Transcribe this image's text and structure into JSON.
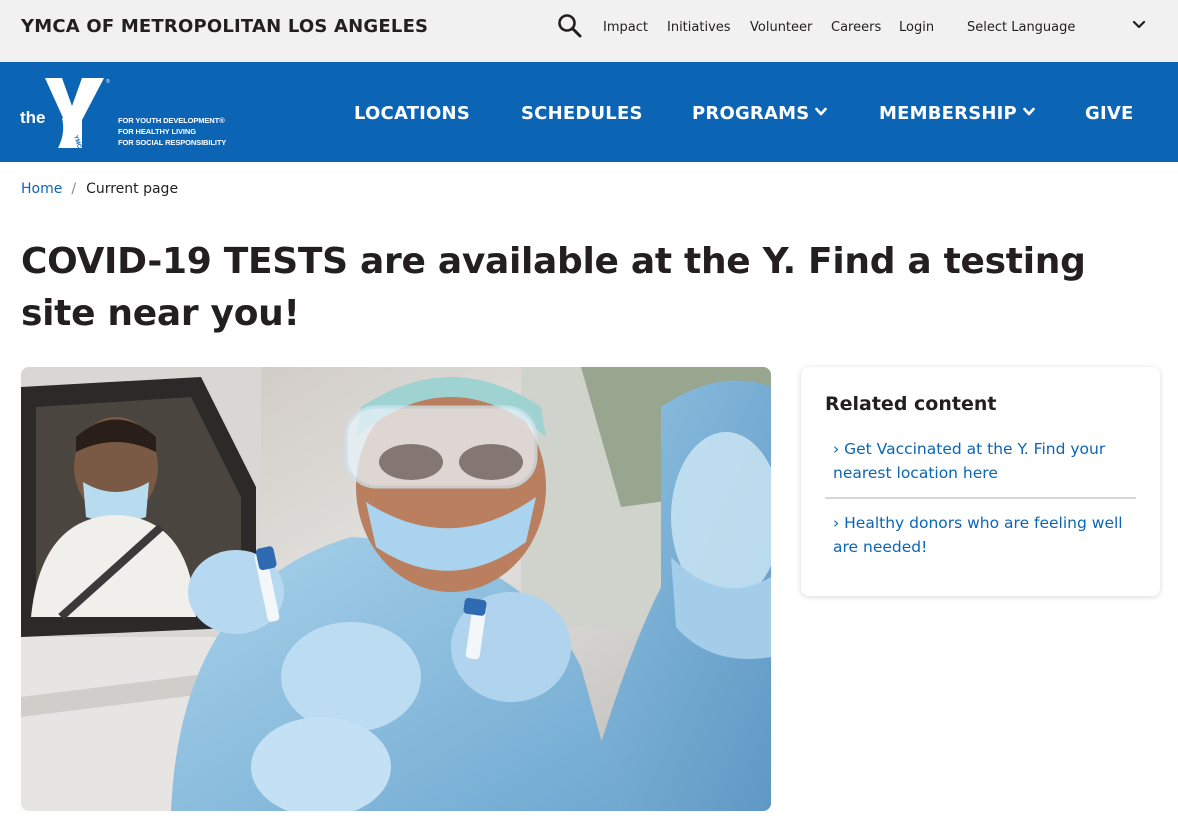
{
  "header": {
    "org_name": "YMCA OF METROPOLITAN LOS ANGELES",
    "utility_links": [
      "Impact",
      "Initiatives",
      "Volunteer",
      "Careers",
      "Login"
    ],
    "language_select": "Select Language"
  },
  "logo": {
    "word": "the",
    "mark_text": "YMCA",
    "tagline": [
      "FOR YOUTH DEVELOPMENT®",
      "FOR HEALTHY LIVING",
      "FOR SOCIAL RESPONSIBILITY"
    ]
  },
  "nav": {
    "items": [
      {
        "label": "LOCATIONS"
      },
      {
        "label": "SCHEDULES"
      },
      {
        "label": "PROGRAMS"
      },
      {
        "label": "MEMBERSHIP"
      },
      {
        "label": "GIVE"
      }
    ]
  },
  "breadcrumb": {
    "home": "Home",
    "separator": "/",
    "current": "Current page"
  },
  "page": {
    "title": "COVID-19 TESTS are available at the Y. Find a testing site near you!"
  },
  "related": {
    "title": "Related content",
    "links": [
      "› Get Vaccinated at the Y. Find your nearest location here",
      "› Healthy donors who are feeling well are needed!"
    ]
  },
  "colors": {
    "brand_blue": "#0c65b4",
    "utility_bg": "#f1f1f1",
    "text": "#231f20"
  },
  "icons": {
    "search": "search-icon",
    "language_dropdown": "chevron-down-icon",
    "nav_dropdown": "chevron-down-icon"
  }
}
